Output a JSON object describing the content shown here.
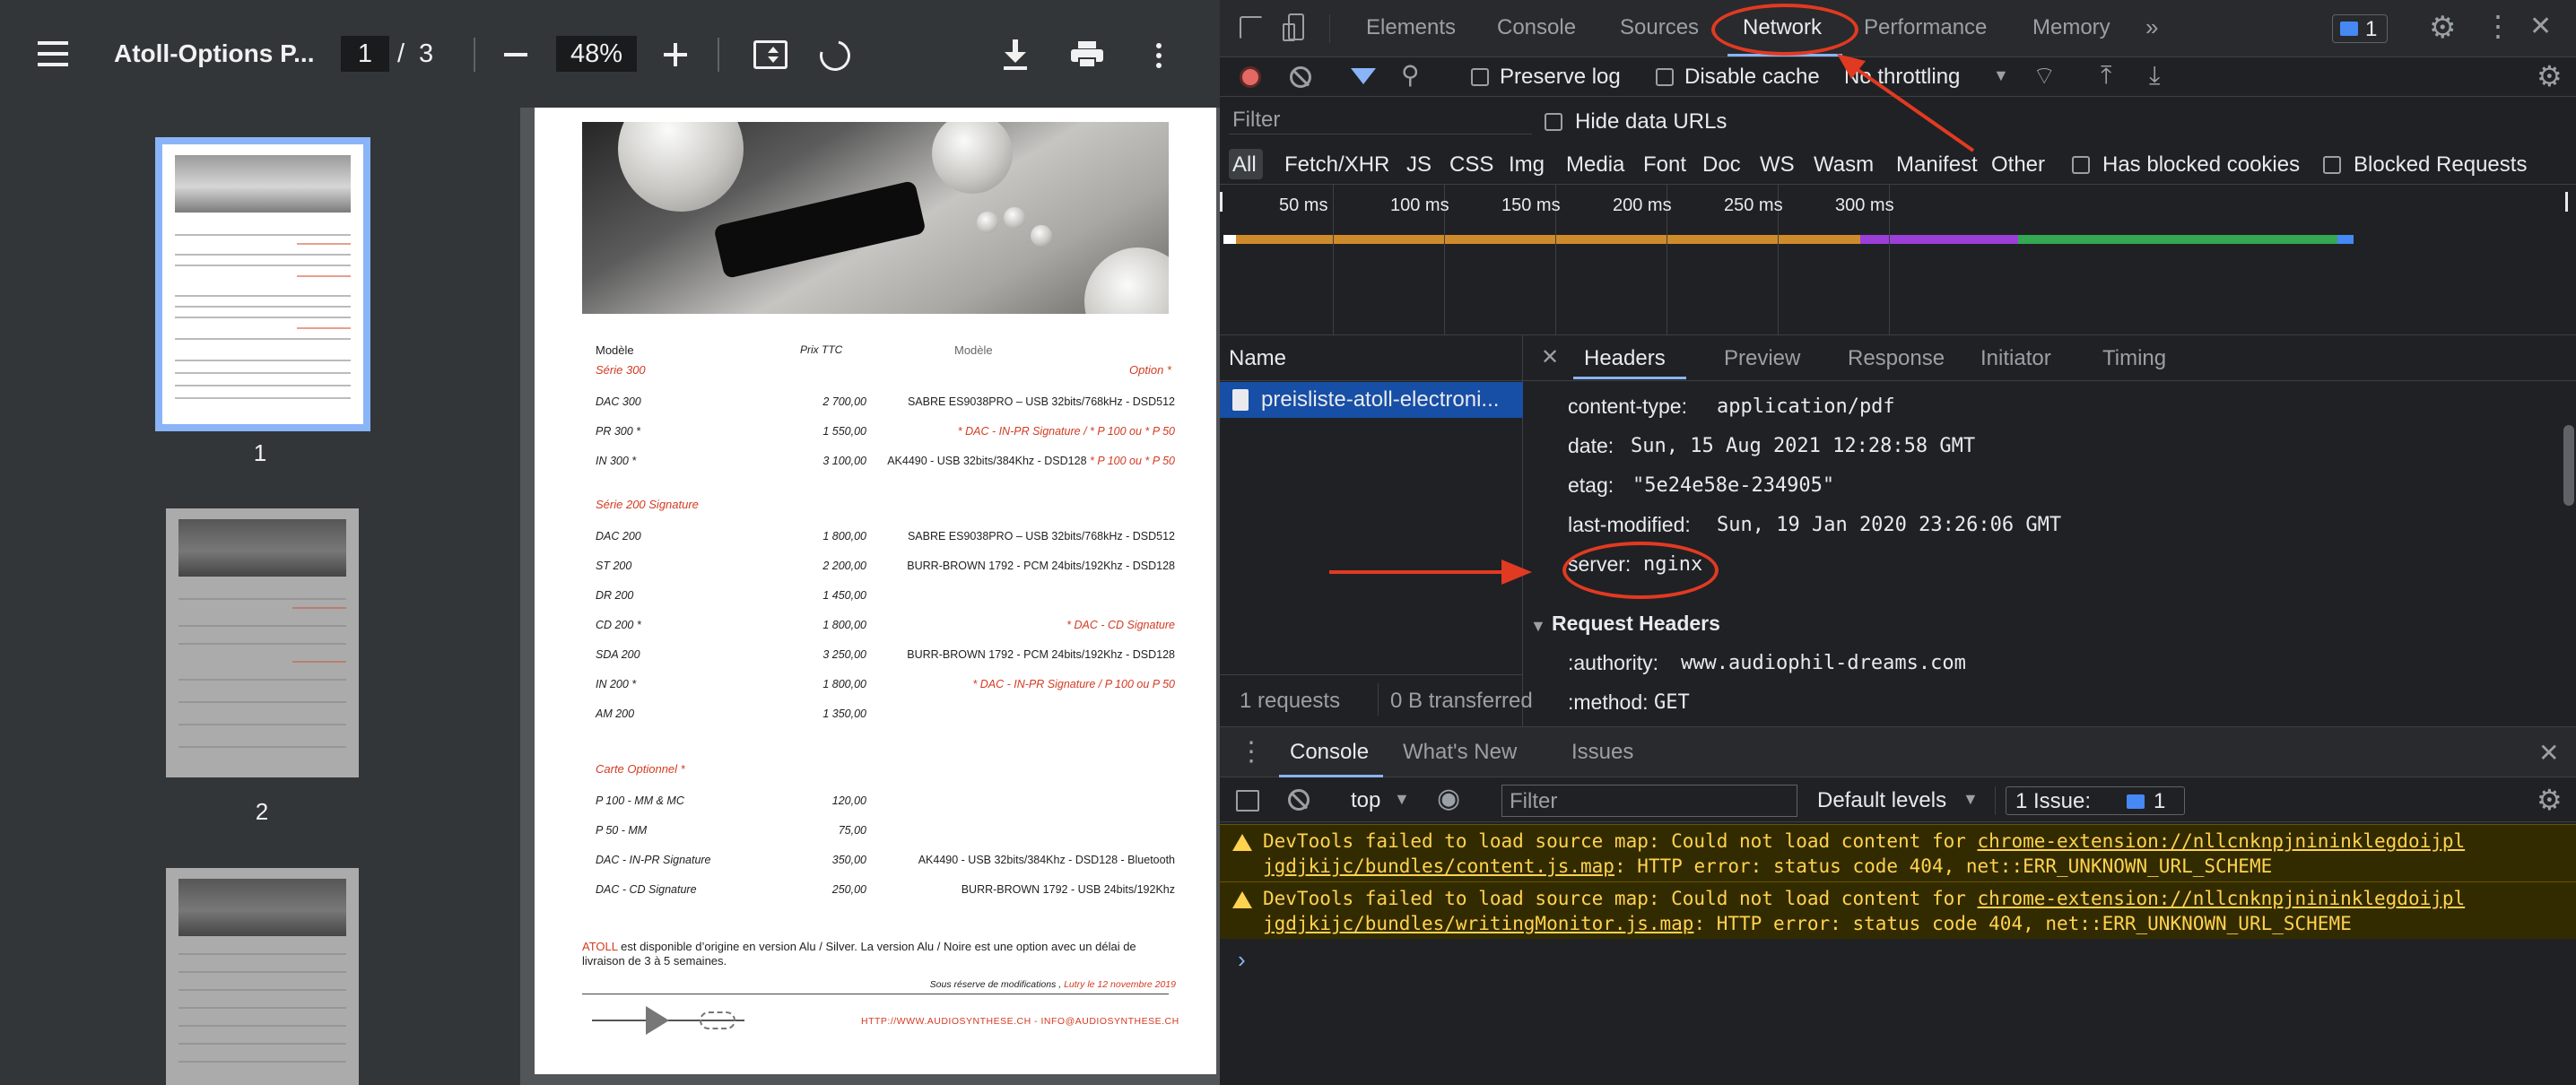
{
  "pdf_viewer": {
    "title": "Atoll-Options P...",
    "page_current": "1",
    "page_separator": "/",
    "page_total": "3",
    "zoom": "48%",
    "thumbnails": [
      "1",
      "2"
    ]
  },
  "pdf_page": {
    "col_model": "Modèle",
    "col_price": "Prix TTC",
    "col_model2": "Modèle",
    "sections": [
      {
        "title": "Série 300",
        "option": "Option *",
        "rows": [
          {
            "model": "DAC 300",
            "price": "2 700,00",
            "desc": "SABRE ES9038PRO – USB 32bits/768kHz - DSD512",
            "red": false
          },
          {
            "model": "PR 300 *",
            "price": "1 550,00",
            "desc": "* DAC - IN-PR Signature / * P 100 ou * P 50",
            "red": true
          },
          {
            "model": "IN 300 *",
            "price": "3 100,00",
            "desc": "AK4490 - USB 32bits/384Khz - DSD128",
            "desc_red": " * P 100 ou * P 50",
            "red": false
          }
        ]
      },
      {
        "title": "Série 200 Signature",
        "rows": [
          {
            "model": "DAC 200",
            "price": "1 800,00",
            "desc": "SABRE ES9038PRO – USB 32bits/768kHz - DSD512",
            "red": false
          },
          {
            "model": "ST 200",
            "price": "2 200,00",
            "desc": "BURR-BROWN 1792 - PCM 24bits/192Khz - DSD128",
            "red": false
          },
          {
            "model": "DR 200",
            "price": "1 450,00",
            "desc": "",
            "red": false
          },
          {
            "model": "CD 200 *",
            "price": "1 800,00",
            "desc": "* DAC - CD Signature",
            "red": true
          },
          {
            "model": "SDA 200",
            "price": "3 250,00",
            "desc": "BURR-BROWN 1792 - PCM 24bits/192Khz - DSD128",
            "red": false
          },
          {
            "model": "IN 200 *",
            "price": "1 800,00",
            "desc": "* DAC - IN-PR Signature / P 100 ou P 50",
            "red": true
          },
          {
            "model": "AM 200",
            "price": "1 350,00",
            "desc": "",
            "red": false
          }
        ]
      },
      {
        "title": "Carte Optionnel *",
        "rows": [
          {
            "model": "P 100 - MM & MC",
            "price": "120,00",
            "desc": "",
            "red": false
          },
          {
            "model": "P 50 - MM",
            "price": "75,00",
            "desc": "",
            "red": false
          },
          {
            "model": "DAC - IN-PR Signature",
            "price": "350,00",
            "desc": "AK4490 - USB 32bits/384Khz - DSD128 - Bluetooth",
            "red": false
          },
          {
            "model": "DAC - CD Signature",
            "price": "250,00",
            "desc": "BURR-BROWN 1792 - USB 24bits/192Khz",
            "red": false
          }
        ]
      }
    ],
    "footnote_brand": "ATOLL",
    "footnote_text": " est disponible d’origine en version Alu / Silver. La version Alu / Noire est une option avec un délai de livraison de 3 à 5 semaines.",
    "reserve": "Sous réserve de modifications , ",
    "reserve_date": "Lutry le 12 novembre 2019",
    "footer_url": "HTTP://WWW.AUDIOSYNTHESE.CH - INFO@AUDIOSYNTHESE.CH"
  },
  "devtools": {
    "main_tabs": [
      "Elements",
      "Console",
      "Sources",
      "Network",
      "Performance",
      "Memory"
    ],
    "issues_badge": "1",
    "toolbar": {
      "preserve_log": "Preserve log",
      "disable_cache": "Disable cache",
      "throttling": "No throttling"
    },
    "filter_placeholder": "Filter",
    "hide_data_urls": "Hide data URLs",
    "type_filters": [
      "All",
      "Fetch/XHR",
      "JS",
      "CSS",
      "Img",
      "Media",
      "Font",
      "Doc",
      "WS",
      "Wasm",
      "Manifest",
      "Other"
    ],
    "has_blocked_cookies": "Has blocked cookies",
    "blocked_requests": "Blocked Requests",
    "timeline_ticks": [
      "50 ms",
      "100 ms",
      "150 ms",
      "200 ms",
      "250 ms",
      "300 ms"
    ],
    "request_list": {
      "header": "Name",
      "items": [
        "preisliste-atoll-electroni..."
      ],
      "summary_requests": "1 requests",
      "summary_transferred": "0 B transferred"
    },
    "detail_tabs": [
      "Headers",
      "Preview",
      "Response",
      "Initiator",
      "Timing"
    ],
    "response_headers": [
      {
        "name": "content-type:",
        "value": "application/pdf"
      },
      {
        "name": "date:",
        "value": "Sun, 15 Aug 2021 12:28:58 GMT"
      },
      {
        "name": "etag:",
        "value": "\"5e24e58e-234905\""
      },
      {
        "name": "last-modified:",
        "value": "Sun, 19 Jan 2020 23:26:06 GMT"
      },
      {
        "name": "server:",
        "value": "nginx"
      }
    ],
    "request_headers_title": "Request Headers",
    "request_headers": [
      {
        "name": ":authority:",
        "value": "www.audiophil-dreams.com"
      },
      {
        "name": ":method:",
        "value": "GET"
      }
    ],
    "drawer": {
      "tabs": [
        "Console",
        "What's New",
        "Issues"
      ],
      "context": "top",
      "filter_placeholder": "Filter",
      "levels": "Default levels",
      "issues_label": "1 Issue:",
      "issues_count": "1",
      "messages": [
        {
          "pre": "DevTools failed to load source map: Could not load content for ",
          "link": "chrome-extension://nllcnknpjnininklegdoijpljgdjkijc/bundles/content.js.map",
          "post": ": HTTP error: status code 404, net::ERR_UNKNOWN_URL_SCHEME",
          "link_a": "chrome-extension://nllcnknpjnininklegdoijpl",
          "link_b": "jgdjkijc/bundles/content.js.map"
        },
        {
          "pre": "DevTools failed to load source map: Could not load content for ",
          "link": "chrome-extension://nllcnknpjnininklegdoijpljgdjkijc/bundles/writingMonitor.js.map",
          "post": ": HTTP error: status code 404, net::ERR_UNKNOWN_URL_SCHEME",
          "link_a": "chrome-extension://nllcnknpjnininklegdoijpl",
          "link_b": "jgdjkijc/bundles/writingMonitor.js.map"
        }
      ],
      "prompt": "›"
    }
  },
  "colors": {
    "annotation": "#e13a22",
    "accent": "#8ab4f8",
    "warning_bg": "#332b00"
  }
}
